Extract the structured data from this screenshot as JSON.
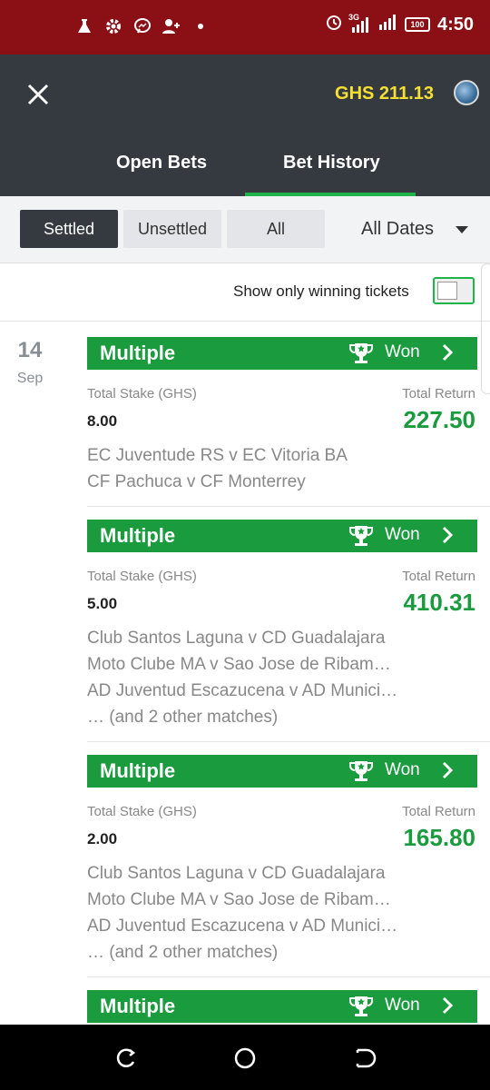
{
  "status_bar": {
    "network": "3G",
    "battery": "100",
    "time": "4:50"
  },
  "header": {
    "balance": "GHS 211.13",
    "tabs": [
      {
        "label": "Open Bets"
      },
      {
        "label": "Bet History"
      }
    ],
    "active_tab": "Bet History",
    "accent_color": "#1fb34a"
  },
  "filters": {
    "buttons": [
      {
        "label": "Settled"
      },
      {
        "label": "Unsettled"
      },
      {
        "label": "All"
      }
    ],
    "active": "Settled",
    "date_select": "All Dates"
  },
  "winning_toggle": {
    "label": "Show only winning tickets",
    "checked": false
  },
  "date_group": {
    "day": "14",
    "month": "Sep"
  },
  "bets": [
    {
      "type": "Multiple",
      "status": "Won",
      "stake_label": "Total Stake (GHS)",
      "stake": "8.00",
      "return_label": "Total Return",
      "return": "227.50",
      "matches": [
        "EC Juventude RS v EC Vitoria BA",
        "CF Pachuca v CF Monterrey"
      ]
    },
    {
      "type": "Multiple",
      "status": "Won",
      "stake_label": "Total Stake (GHS)",
      "stake": "5.00",
      "return_label": "Total Return",
      "return": "410.31",
      "matches": [
        "Club Santos Laguna v CD Guadalajara",
        "Moto Clube MA v Sao Jose de Ribam…",
        "AD Juventud Escazucena v AD Munici…",
        "… (and 2 other matches)"
      ]
    },
    {
      "type": "Multiple",
      "status": "Won",
      "stake_label": "Total Stake (GHS)",
      "stake": "2.00",
      "return_label": "Total Return",
      "return": "165.80",
      "matches": [
        "Club Santos Laguna v CD Guadalajara",
        "Moto Clube MA v Sao Jose de Ribam…",
        "AD Juventud Escazucena v AD Munici…",
        "… (and 2 other matches)"
      ]
    },
    {
      "type": "Multiple",
      "status": "Won"
    }
  ],
  "colors": {
    "status_bar": "#8b1016",
    "header_bg": "#353a40",
    "won_green": "#1a9b3e",
    "balance_yellow": "#f4e033"
  }
}
